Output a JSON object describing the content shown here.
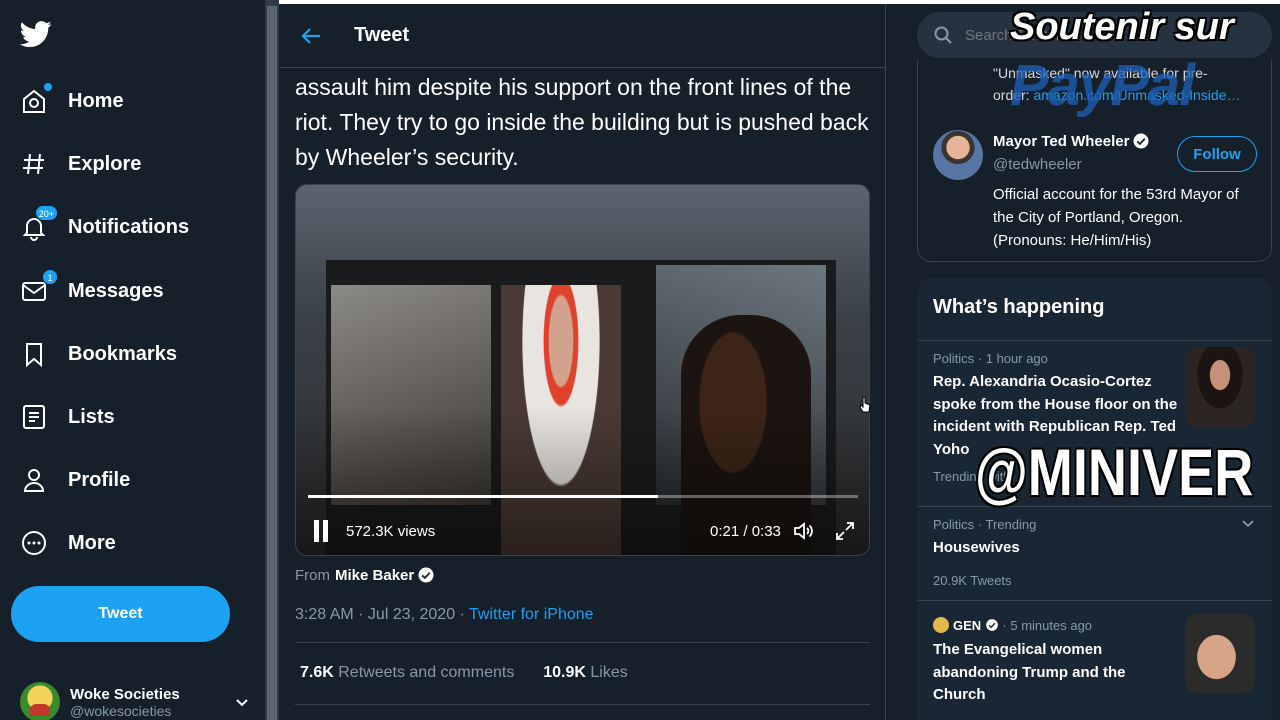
{
  "nav": {
    "items": [
      {
        "label": "Home",
        "icon": "home-icon"
      },
      {
        "label": "Explore",
        "icon": "hashtag-icon"
      },
      {
        "label": "Notifications",
        "icon": "bell-icon",
        "badge": "20+"
      },
      {
        "label": "Messages",
        "icon": "envelope-icon",
        "badge": "1"
      },
      {
        "label": "Bookmarks",
        "icon": "bookmark-icon"
      },
      {
        "label": "Lists",
        "icon": "list-icon"
      },
      {
        "label": "Profile",
        "icon": "person-icon"
      },
      {
        "label": "More",
        "icon": "more-icon"
      }
    ],
    "tweet_button": "Tweet",
    "account": {
      "name": "Woke Societies",
      "handle": "@wokesocieties"
    }
  },
  "main": {
    "title": "Tweet",
    "text": "assault him despite his support on the front lines of the riot. They try to go inside the building but is pushed back by Wheeler’s security.",
    "video": {
      "views": "572.3K views",
      "time": "0:21 / 0:33",
      "progress": 0.636
    },
    "from_prefix": "From",
    "from_name": "Mike Baker",
    "timestamp": "3:28 AM · Jul 23, 2020 · ",
    "source": "Twitter for iPhone",
    "retweets_count": "7.6K",
    "retweets_label": "Retweets and comments",
    "likes_count": "10.9K",
    "likes_label": "Likes"
  },
  "right": {
    "search_placeholder": "Search Twitter",
    "prev_line1_a": "\"Unmasked\" now available for pre-",
    "prev_line2_a": "order: ",
    "prev_line2_link": "amazon.com/Unmasked-Inside…",
    "person": {
      "name": "Mayor Ted Wheeler",
      "handle": "@tedwheeler",
      "bio": "Official account for the 53rd Mayor of the City of Portland, Oregon. (Pronouns: He/Him/His)",
      "follow": "Follow"
    },
    "happening_title": "What’s happening",
    "trends": [
      {
        "context": "Politics · 1 hour ago",
        "title": "Rep. Alexandria Ocasio-Cortez spoke from the House floor on the incident with Republican Rep. Ted Yoho",
        "sub": "Trending with"
      },
      {
        "context": "Politics · Trending",
        "title": "Housewives",
        "sub": "20.9K Tweets"
      },
      {
        "context_source": "GEN",
        "context_time": " · 5 minutes ago",
        "title": "The Evangelical women abandoning Trump and the Church"
      }
    ]
  },
  "overlays": {
    "soutenir": "Soutenir sur",
    "paypal": "PayPal",
    "miniver": "@MINIVER"
  },
  "colors": {
    "bg": "#15202b",
    "accent": "#1da1f2",
    "muted": "#8899a6",
    "border": "#38444d"
  }
}
